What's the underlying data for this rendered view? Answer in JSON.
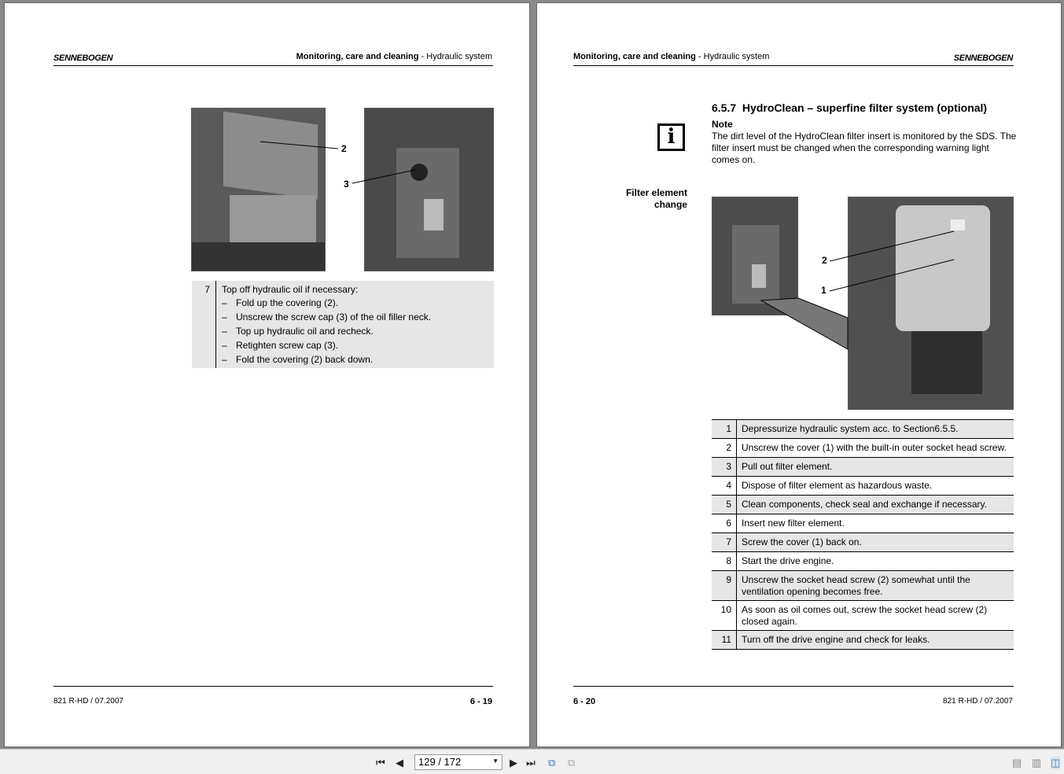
{
  "left_page": {
    "logo": "SENNEBOGEN",
    "header_bold": "Monitoring, care and cleaning",
    "header_rest": " - Hydraulic system",
    "callouts": [
      "2",
      "3"
    ],
    "step": {
      "number": "7",
      "title": "Top off hydraulic oil if necessary:",
      "items": [
        "Fold up the covering (2).",
        "Unscrew the screw cap (3) of the oil filler neck.",
        "Top up hydraulic oil and recheck.",
        "Retighten screw cap (3).",
        "Fold the covering (2) back down."
      ]
    },
    "footer_left": "821 R-HD / 07.2007",
    "page_number": "6 - 19"
  },
  "right_page": {
    "logo": "SENNEBOGEN",
    "header_bold": "Monitoring, care and cleaning",
    "header_rest": " - Hydraulic system",
    "section_number": "6.5.7",
    "section_title": "HydroClean – superfine filter system (optional)",
    "note_title": "Note",
    "note_text": "The dirt level of the HydroClean filter insert is monitored by the SDS. The filter insert must be changed when the corresponding warning light comes on.",
    "side_label": "Filter element change",
    "callouts": [
      "2",
      "1"
    ],
    "steps": [
      {
        "n": "1",
        "t": "Depressurize hydraulic system acc. to Section6.5.5."
      },
      {
        "n": "2",
        "t": "Unscrew the cover (1) with the built-in outer socket head screw."
      },
      {
        "n": "3",
        "t": "Pull out filter element."
      },
      {
        "n": "4",
        "t": "Dispose of filter element as hazardous waste."
      },
      {
        "n": "5",
        "t": "Clean components, check seal and exchange if necessary."
      },
      {
        "n": "6",
        "t": "Insert new filter element."
      },
      {
        "n": "7",
        "t": "Screw the cover (1) back on."
      },
      {
        "n": "8",
        "t": "Start the drive engine."
      },
      {
        "n": "9",
        "t": "Unscrew the socket head screw (2) somewhat until the ventilation opening becomes free."
      },
      {
        "n": "10",
        "t": "As soon as oil comes out, screw the socket head screw (2) closed again."
      },
      {
        "n": "11",
        "t": "Turn off the drive engine and check for leaks."
      }
    ],
    "page_number": "6 - 20",
    "footer_right": "821 R-HD / 07.2007"
  },
  "toolbar": {
    "page_field": "129 / 172"
  }
}
